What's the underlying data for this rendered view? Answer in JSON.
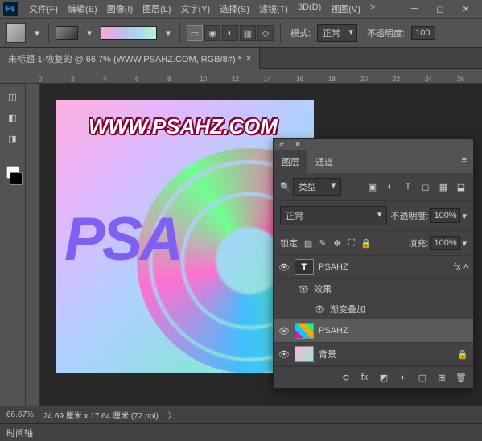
{
  "menu": {
    "file": "文件(F)",
    "edit": "编辑(E)",
    "image": "图像(I)",
    "layer": "图层(L)",
    "type": "文字(Y)",
    "select": "选择(S)",
    "filter": "滤镜(T)",
    "threeD": "3D(D)",
    "view": "视图(V)",
    "extra": ">"
  },
  "options": {
    "mode_label": "模式:",
    "mode_value": "正常",
    "opacity_label": "不透明度:",
    "opacity_value": "100"
  },
  "tab": {
    "title": "未标题-1-恢复的 @ 66.7% (WWW.PSAHZ.COM, RGB/8#) *"
  },
  "ruler": {
    "marks": [
      "0",
      "2",
      "4",
      "6",
      "8",
      "10",
      "12",
      "14",
      "16",
      "18",
      "20",
      "22",
      "24",
      "26"
    ]
  },
  "canvas": {
    "url": "WWW.PSAHZ.COM",
    "big_text": "PSA"
  },
  "layers_panel": {
    "tabs": {
      "layers": "图层",
      "channels": "通道"
    },
    "filter": {
      "kind": "类型"
    },
    "blend": {
      "mode": "正常",
      "opacity_label": "不透明度:",
      "opacity_value": "100%"
    },
    "lock": {
      "label": "锁定:",
      "fill_label": "填充:",
      "fill_value": "100%"
    },
    "layers": [
      {
        "name": "PSAHZ",
        "type": "text"
      },
      {
        "name": "效果",
        "type": "fx"
      },
      {
        "name": "渐变叠加",
        "type": "fxitem"
      },
      {
        "name": "PSAHZ",
        "type": "image",
        "selected": true
      },
      {
        "name": "背景",
        "type": "bg"
      }
    ]
  },
  "status": {
    "zoom": "66.67%",
    "dims": "24.69 厘米 x 17.64 厘米 (72 ppi)"
  },
  "timeline": {
    "label": "时间轴"
  }
}
